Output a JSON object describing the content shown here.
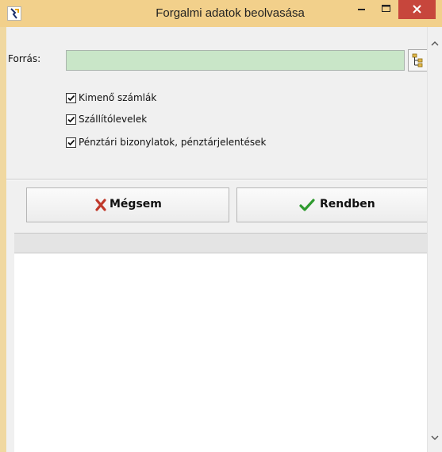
{
  "window": {
    "title": "Forgalmi adatok beolvasása",
    "icon": "app-icon",
    "controls": [
      "minimize-icon",
      "maximize-icon",
      "close-icon"
    ],
    "colors": {
      "titlebar": "#f2d08b",
      "close": "#c7463c"
    }
  },
  "source": {
    "label": "Forrás:",
    "value": "",
    "browse_icon": "folder-tree-icon",
    "colors": {
      "input_bg": "#c9e6c8"
    }
  },
  "options": [
    {
      "label": "Kimenő számlák",
      "checked": true
    },
    {
      "label": "Szállítólevelek",
      "checked": true
    },
    {
      "label": "Pénztári bizonylatok, pénztárjelentések",
      "checked": true
    }
  ],
  "buttons": {
    "cancel": {
      "label": "Mégsem",
      "icon": "red-x-icon",
      "color": "#c0392b"
    },
    "ok": {
      "label": "Rendben",
      "icon": "green-check-icon",
      "color": "#2e9a2e"
    }
  }
}
